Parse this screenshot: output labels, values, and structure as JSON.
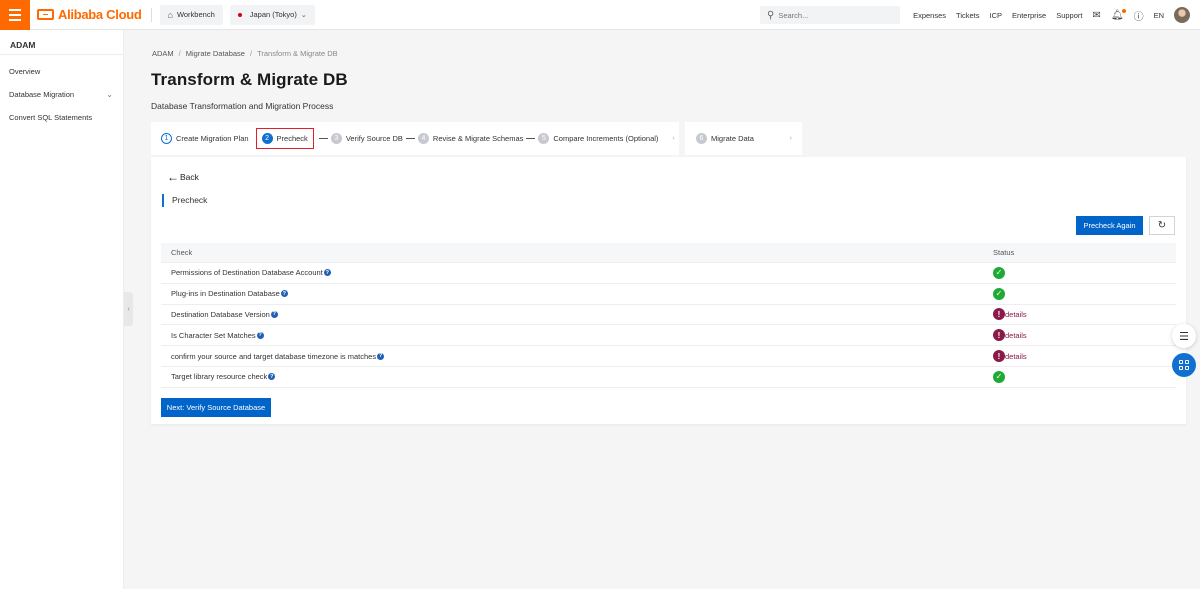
{
  "topbar": {
    "brand": "Alibaba Cloud",
    "workbench": "Workbench",
    "region": "Japan (Tokyo)",
    "search_placeholder": "Search...",
    "links": [
      "Expenses",
      "Tickets",
      "ICP",
      "Enterprise",
      "Support"
    ],
    "language": "EN"
  },
  "sidebar": {
    "product": "ADAM",
    "items": [
      {
        "label": "Overview"
      },
      {
        "label": "Database Migration"
      },
      {
        "label": "Convert SQL Statements"
      }
    ]
  },
  "breadcrumb": [
    "ADAM",
    "Migrate Database",
    "Transform & Migrate DB"
  ],
  "page": {
    "title": "Transform & Migrate DB",
    "subtitle": "Database Transformation and Migration Process"
  },
  "steps": [
    {
      "num": "1",
      "label": "Create Migration Plan",
      "state": "done"
    },
    {
      "num": "2",
      "label": "Precheck",
      "state": "active"
    },
    {
      "num": "3",
      "label": "Verify Source DB",
      "state": "pending"
    },
    {
      "num": "4",
      "label": "Revise & Migrate Schemas",
      "state": "pending"
    },
    {
      "num": "5",
      "label": "Compare Increments (Optional)",
      "state": "pending"
    },
    {
      "num": "6",
      "label": "Migrate Data",
      "state": "pending"
    }
  ],
  "panel": {
    "back": "Back",
    "section": "Precheck",
    "precheck_again": "Precheck Again",
    "next": "Next: Verify Source Database",
    "table": {
      "headers": [
        "Check",
        "Status"
      ],
      "rows": [
        {
          "check": "Permissions of Destination Database Account",
          "status": "pass"
        },
        {
          "check": "Plug-ins in Destination Database",
          "status": "pass"
        },
        {
          "check": "Destination Database Version",
          "status": "warning",
          "link": "details"
        },
        {
          "check": "Is Character Set Matches",
          "status": "warning",
          "link": "details"
        },
        {
          "check": "confirm your source and target database timezone is matches",
          "status": "warning",
          "link": "details"
        },
        {
          "check": "Target library resource check",
          "status": "pass"
        }
      ]
    }
  },
  "colors": {
    "brand": "#ff6a00",
    "primary": "#0064c8",
    "success": "#1eaa34",
    "warning": "#8a1a4a",
    "highlight": "#e0212d"
  }
}
